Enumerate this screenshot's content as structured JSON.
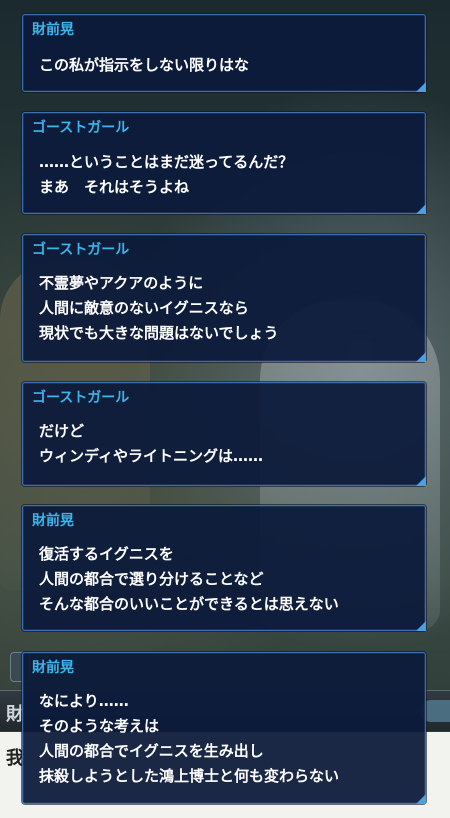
{
  "log": [
    {
      "speaker": "財前晃",
      "lines": [
        "この私が指示をしない限りはな"
      ]
    },
    {
      "speaker": "ゴーストガール",
      "lines": [
        "……ということはまだ迷ってるんだ？",
        "まあ　それはそうよね"
      ]
    },
    {
      "speaker": "ゴーストガール",
      "lines": [
        "不霊夢やアクアのように",
        "人間に敵意のないイグニスなら",
        "現状でも大きな問題はないでしょう"
      ]
    },
    {
      "speaker": "ゴーストガール",
      "lines": [
        "だけど",
        "ウィンディやライトニングは……"
      ]
    },
    {
      "speaker": "財前晃",
      "lines": [
        "復活するイグニスを",
        "人間の都合で選り分けることなど",
        "そんな都合のいいことができるとは思えない"
      ]
    },
    {
      "speaker": "財前晃",
      "lines": [
        "なにより……",
        "そのような考えは",
        "人間の都合でイグニスを生み出し",
        "抹殺しようとした鴻上博士と何も変わらない"
      ]
    }
  ],
  "underlay": {
    "name_fragment": "財",
    "text_fragment": "我"
  },
  "colors": {
    "speaker": "#3ab6ea",
    "bubble_bg": "#0c1b3a",
    "bubble_border": "#3f6fb0",
    "text": "#ffffff"
  }
}
